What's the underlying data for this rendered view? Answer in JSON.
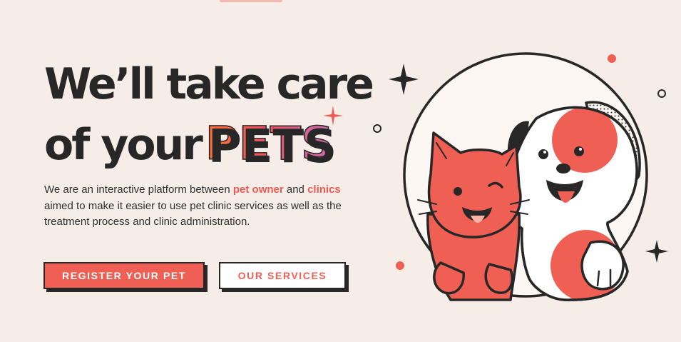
{
  "hero": {
    "headline_line1": "We’ll take care",
    "headline_line2_prefix": "of your",
    "headline_highlight": "PETS",
    "description": {
      "part1": "We are an interactive platform between ",
      "highlight1": "pet owner",
      "part2": " and ",
      "highlight2": "clinics",
      "part3": " aimed to make it easier to use pet clinic services as well as the treatment process and clinic administration."
    }
  },
  "buttons": {
    "register_label": "REGISTER YOUR PET",
    "services_label": "OUR SERVICES"
  },
  "illustration": {
    "subject": "cat and dog inside a circular frame",
    "icons": [
      "sparkle-icon",
      "dot-icon",
      "ring-icon"
    ]
  },
  "colors": {
    "background": "#f7ede8",
    "accent": "#ef5f53",
    "text": "#272727",
    "pets_gradient": [
      "#ff7038",
      "#f0545e",
      "#c86cb4"
    ]
  }
}
